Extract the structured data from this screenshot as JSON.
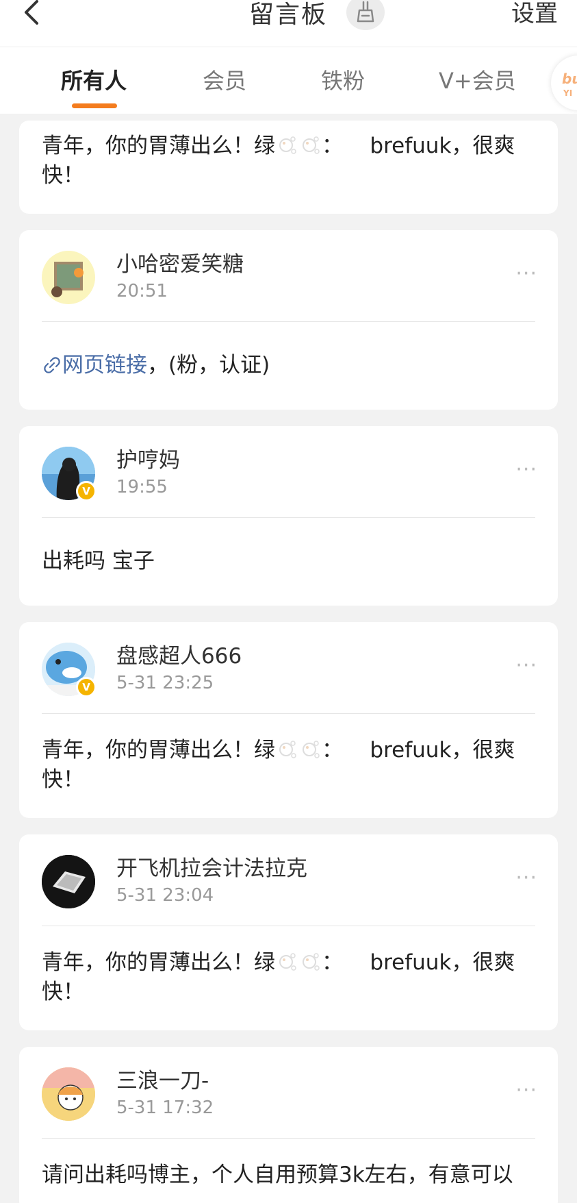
{
  "header": {
    "title": "留言板",
    "settings_label": "设置"
  },
  "tabs": [
    {
      "label": "所有人"
    },
    {
      "label": "会员"
    },
    {
      "label": "铁粉"
    },
    {
      "label": "V+会员"
    }
  ],
  "promo_badge": {
    "text": "bu",
    "subtext": "YI"
  },
  "colors": {
    "accent": "#f47c1e",
    "link": "#4a6da7",
    "verified": "#f5b400"
  },
  "messages": [
    {
      "text_prefix": "青年，你的胃薄出么！绿",
      "text_mid": "：",
      "text_suffix": "brefuuk，很爽快！"
    },
    {
      "name": "小哈密爱笑糖",
      "time": "20:51",
      "link_label": "网页链接",
      "text_after_link": "，(粉，认证)"
    },
    {
      "name": "护哼妈",
      "time": "19:55",
      "verified": true,
      "text": "出耗吗 宝子"
    },
    {
      "name": "盘感超人666",
      "time": "5-31 23:25",
      "verified": true,
      "text_prefix": "青年，你的胃薄出么！绿",
      "text_mid": "：",
      "text_suffix": "brefuuk，很爽快！"
    },
    {
      "name": "开飞机拉会计法拉克",
      "time": "5-31 23:04",
      "text_prefix": "青年，你的胃薄出么！绿",
      "text_mid": "：",
      "text_suffix": "brefuuk，很爽快！"
    },
    {
      "name": "三浪一刀-",
      "time": "5-31 17:32",
      "text": "请问出耗吗博主，个人自用预算3k左右，有意可以"
    }
  ],
  "icons": {
    "back": "chevron-left-icon",
    "clean": "broom-icon",
    "more": "more-dots-icon",
    "link": "link-icon"
  },
  "more_label": "···",
  "verified_label": "V"
}
